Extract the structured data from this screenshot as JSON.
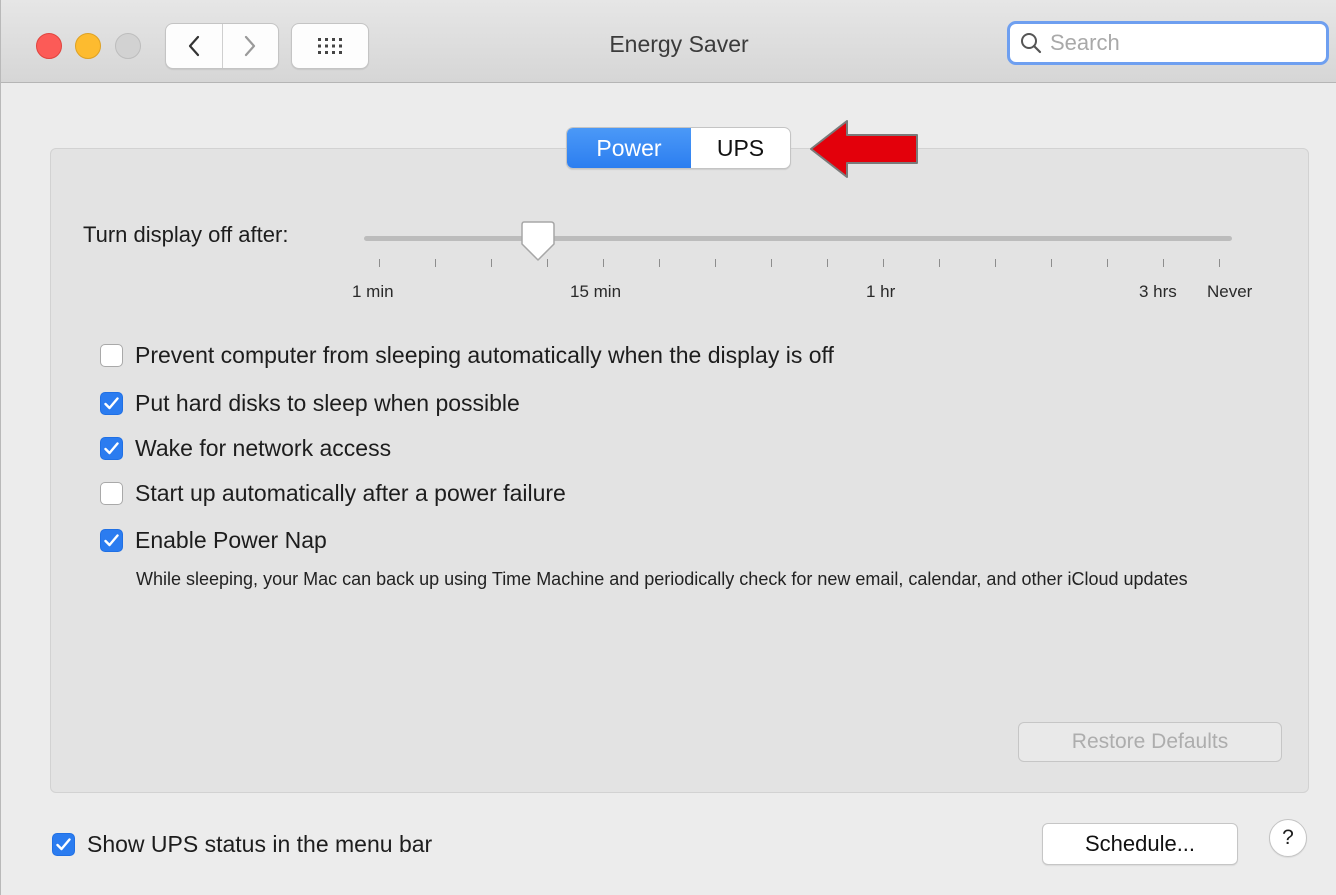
{
  "window": {
    "title": "Energy Saver",
    "search_placeholder": "Search",
    "search_value": ""
  },
  "tabs": [
    {
      "label": "Power",
      "selected": true
    },
    {
      "label": "UPS",
      "selected": false
    }
  ],
  "slider": {
    "label": "Turn display off after:",
    "selected_level": 0.2,
    "tick_labels": [
      "1 min",
      "15 min",
      "1 hr",
      "3 hrs",
      "Never"
    ]
  },
  "options": [
    {
      "label": "Prevent computer from sleeping automatically when the display is off",
      "checked": false
    },
    {
      "label": "Put hard disks to sleep when possible",
      "checked": true
    },
    {
      "label": "Wake for network access",
      "checked": true
    },
    {
      "label": "Start up automatically after a power failure",
      "checked": false
    },
    {
      "label": "Enable Power Nap",
      "checked": true
    }
  ],
  "power_nap_description": "While sleeping, your Mac can back up using Time Machine and periodically check for new email, calendar, and other iCloud updates",
  "buttons": {
    "restore_defaults": "Restore Defaults",
    "schedule": "Schedule...",
    "help": "?"
  },
  "ups_status": {
    "label": "Show UPS status in the menu bar",
    "checked": true
  },
  "colors": {
    "accent": "#2b7cf0",
    "close": "#fc5b57",
    "minimize": "#fdbb2f",
    "annotation_arrow": "#e3000b"
  }
}
